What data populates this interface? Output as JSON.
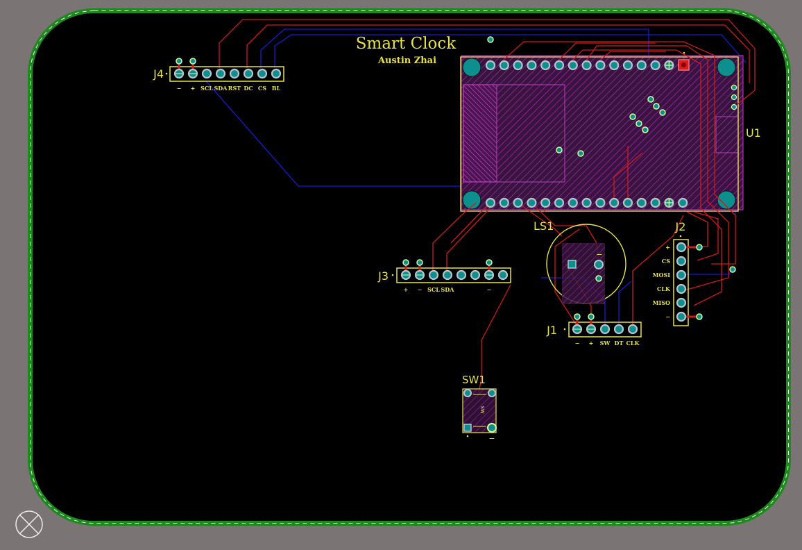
{
  "board": {
    "title": "Smart Clock",
    "author": "Austin Zhai"
  },
  "colors": {
    "background": "#7a7574",
    "board_fill": "#000000",
    "edge": "#1e8a1e",
    "silkscreen": "#e8e24a",
    "top_trace": "#d11a1a",
    "bottom_trace": "#1a1ad6",
    "keepout": "#b62fb6",
    "pad": "#b9c3c9",
    "pad_ring": "#0e8f8f"
  },
  "components": {
    "j4": {
      "designator": "J4",
      "pins": [
        "−",
        "+",
        "SCL",
        "SDA",
        "RST",
        "DC",
        "CS",
        "BL"
      ]
    },
    "j3": {
      "designator": "J3",
      "pins": [
        "+",
        "−",
        "SCL",
        "SDA",
        "",
        "",
        "−",
        ""
      ]
    },
    "j1": {
      "designator": "J1",
      "pins": [
        "−",
        "+",
        "SW",
        "DT",
        "CLK"
      ]
    },
    "j2": {
      "designator": "J2",
      "pins": [
        "+",
        "CS",
        "MOSI",
        "CLK",
        "MISO",
        "−"
      ]
    },
    "u1": {
      "designator": "U1"
    },
    "ls1": {
      "designator": "LS1",
      "pin_minus": "−"
    },
    "sw1": {
      "designator": "SW1",
      "pin_minus": "−",
      "body_text": "SW"
    }
  },
  "icons": {
    "origin": "origin-crosshair-icon"
  }
}
